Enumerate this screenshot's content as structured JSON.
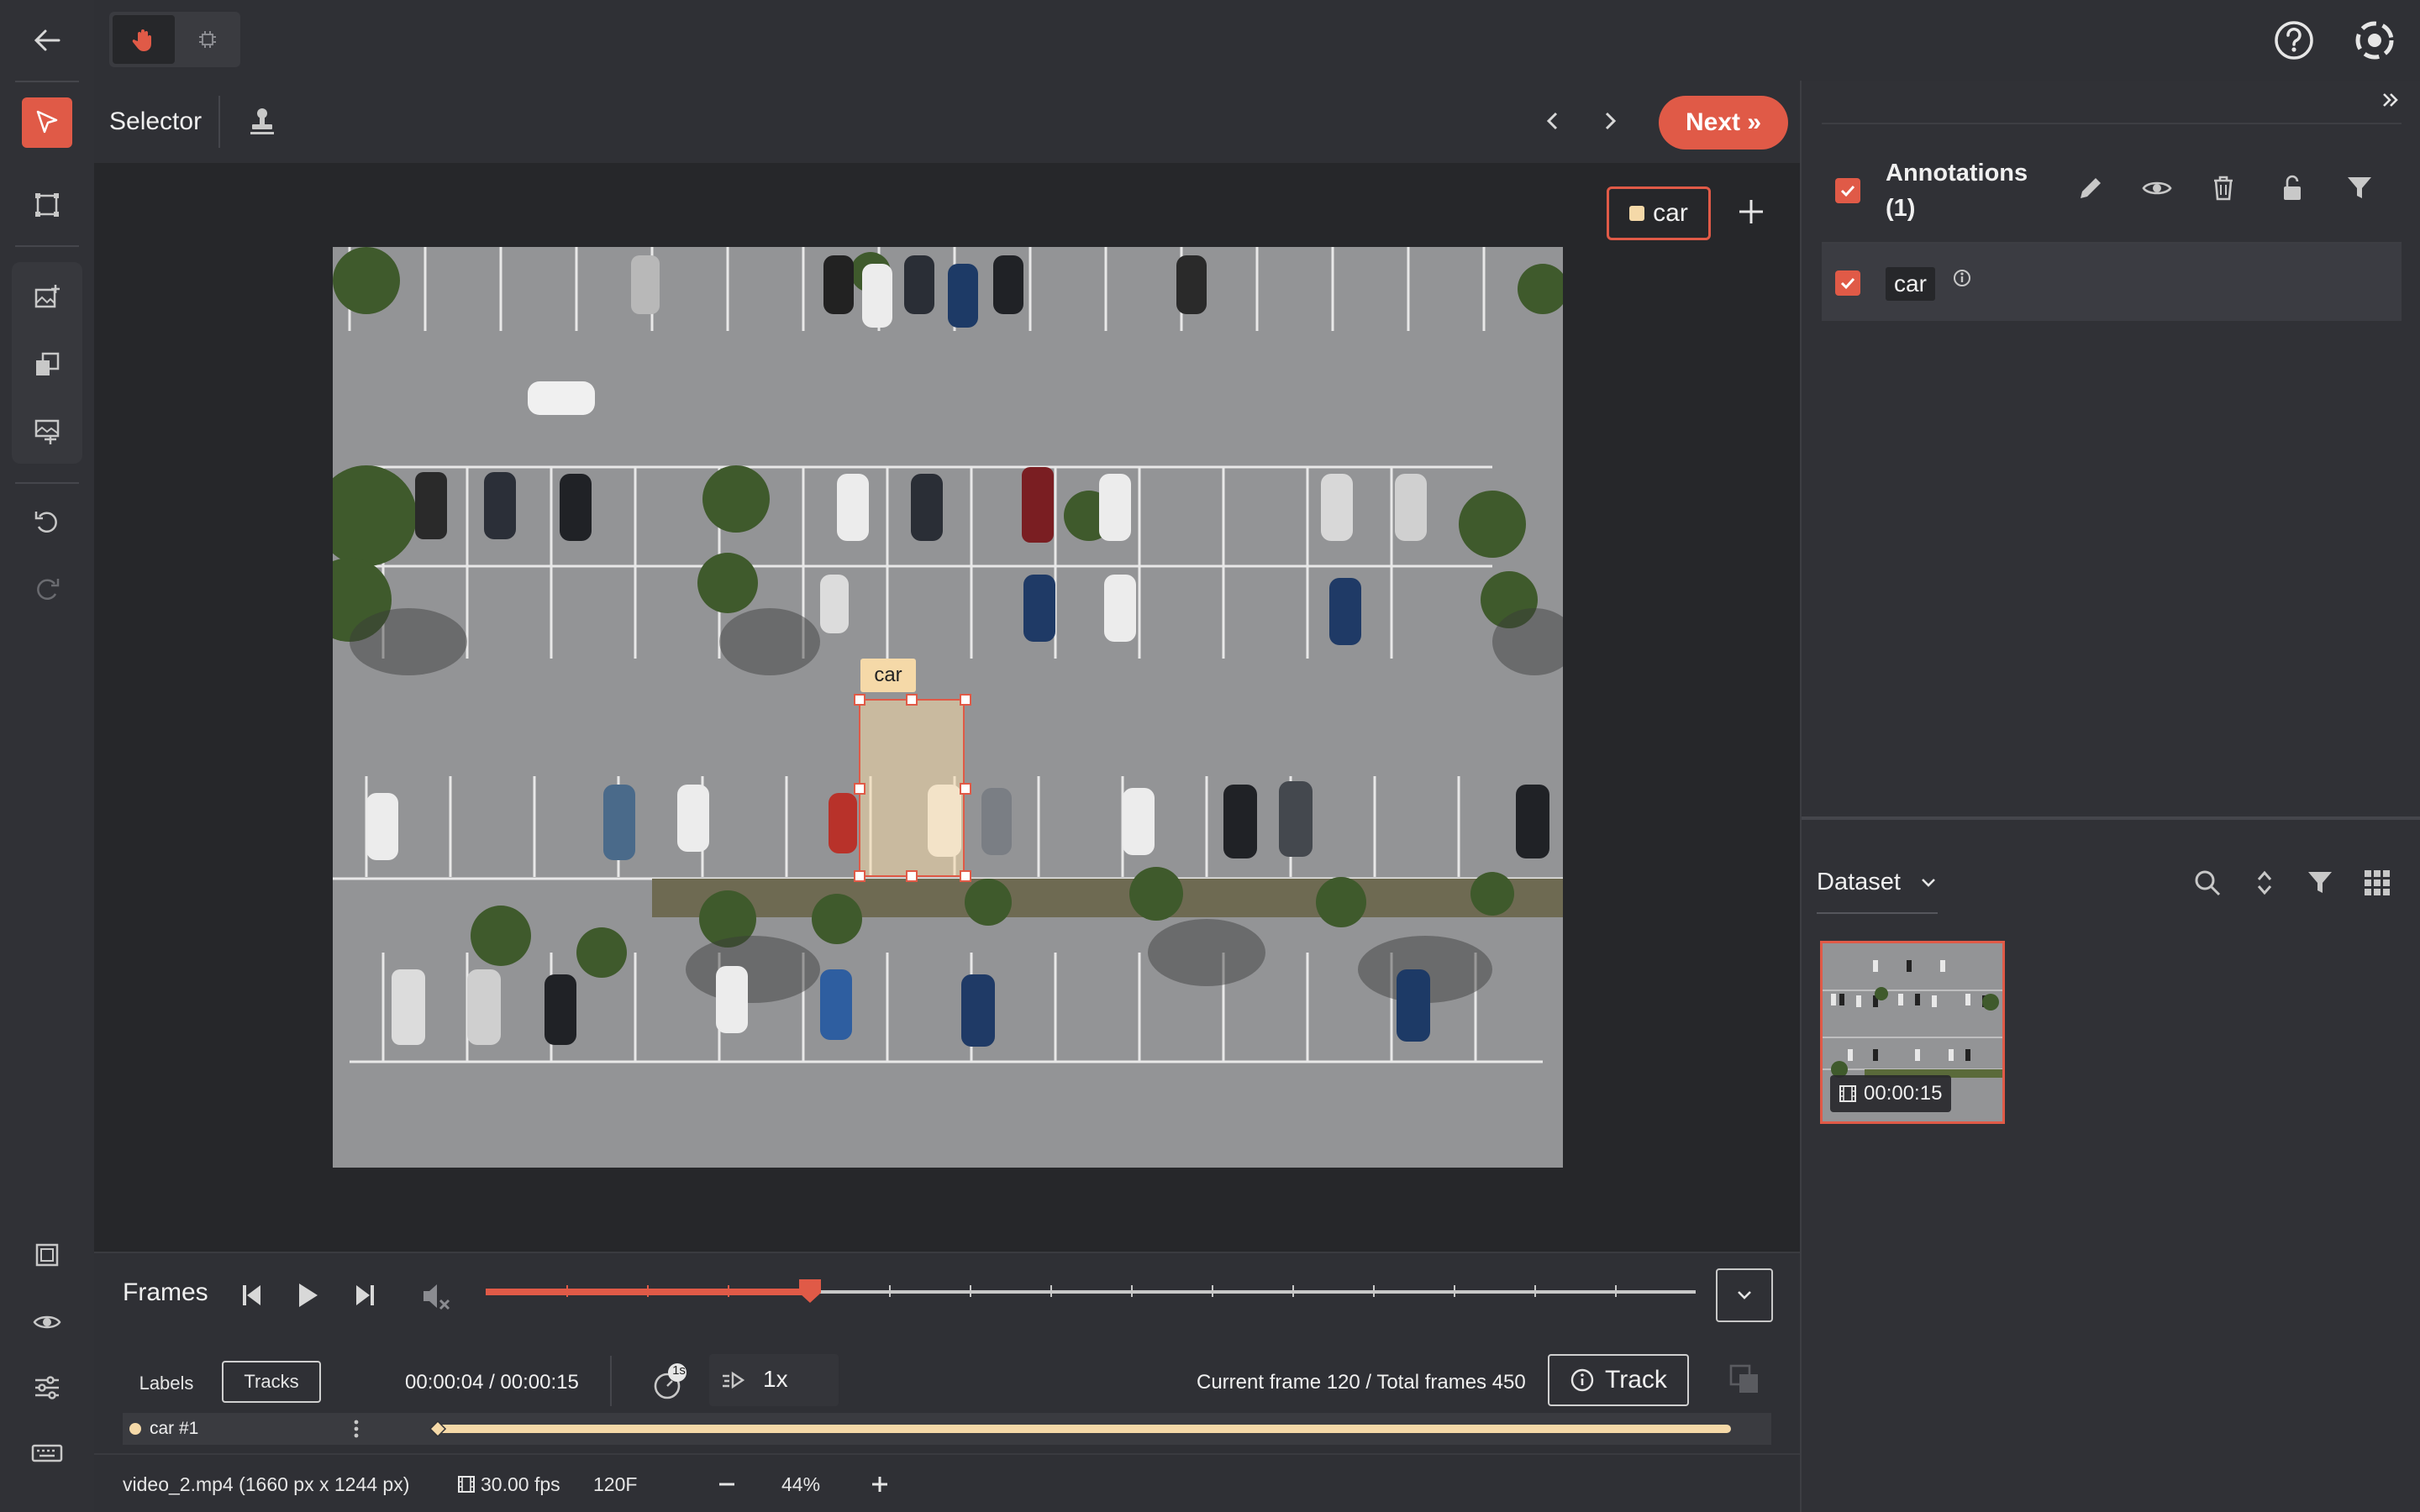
{
  "toolbar": {
    "tool_name": "Selector",
    "next_label": "Next »"
  },
  "labels": {
    "active_label": "car",
    "color": "#f5d9a8"
  },
  "annotations": {
    "title": "Annotations",
    "count": "(1)",
    "items": [
      {
        "label": "car"
      }
    ]
  },
  "canvas": {
    "box_label": "car"
  },
  "dataset": {
    "title": "Dataset",
    "thumbnail_duration": "00:00:15"
  },
  "player": {
    "frames_label": "Frames",
    "progress": 0.268,
    "time": "00:00:04 / 00:00:15",
    "speed": "1x",
    "skip_badge": "1s",
    "frame_info": "Current frame 120 / Total frames 450",
    "track_label": "Track",
    "tabs": [
      "Labels",
      "Tracks"
    ],
    "track_row": "car #1"
  },
  "status": {
    "file": "video_2.mp4 (1660 px x 1244 px)",
    "fps": "30.00 fps",
    "frame": "120F",
    "zoom": "44%"
  },
  "colors": {
    "accent": "#e05a47",
    "label": "#f5d9a8"
  }
}
